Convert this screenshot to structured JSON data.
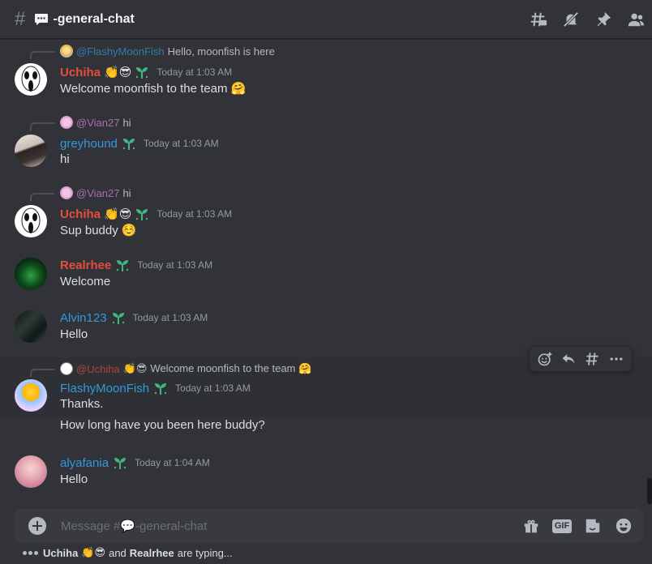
{
  "header": {
    "channel_emoji": "speech-bubble-emoji",
    "title": "-general-chat",
    "tools": [
      "threads-icon",
      "mute-bell-icon",
      "pin-icon",
      "member-list-icon"
    ]
  },
  "messages": [
    {
      "reply_to": {
        "name": "@FlashyMoonFish",
        "text": "Hello, moonfish is here"
      },
      "author": "Uchiha",
      "author_emoji": "👏😎",
      "time": "Today at 1:03 AM",
      "lines": [
        "Welcome moonfish to the team 🤗"
      ]
    },
    {
      "reply_to": {
        "name": "@Vian27",
        "text": "hi"
      },
      "author": "greyhound",
      "author_emoji": "",
      "time": "Today at 1:03 AM",
      "lines": [
        "hi"
      ]
    },
    {
      "reply_to": {
        "name": "@Vian27",
        "text": "hi"
      },
      "author": "Uchiha",
      "author_emoji": "👏😎",
      "time": "Today at 1:03 AM",
      "lines": [
        "Sup buddy ☺️"
      ]
    },
    {
      "author": "Realrhee",
      "author_emoji": "",
      "time": "Today at 1:03 AM",
      "lines": [
        "Welcome"
      ]
    },
    {
      "author": "Alvin123",
      "author_emoji": "",
      "time": "Today at 1:03 AM",
      "lines": [
        "Hello"
      ]
    },
    {
      "reply_to": {
        "name": "@Uchiha",
        "emoji": "👏😎",
        "text": "Welcome moonfish to the team 🤗"
      },
      "author": "FlashyMoonFish",
      "author_emoji": "",
      "time": "Today at 1:03 AM",
      "lines": [
        "Thanks.",
        "How long have you been here buddy?"
      ]
    },
    {
      "author": "alyafania",
      "author_emoji": "",
      "time": "Today at 1:04 AM",
      "lines": [
        "Hello"
      ]
    }
  ],
  "composer": {
    "placeholder": "Message #💬-general-chat",
    "gif_label": "GIF"
  },
  "typing": {
    "user1": "Uchiha",
    "user1_emoji": "👏😎",
    "connector": "and",
    "user2": "Realrhee",
    "suffix": "are typing..."
  },
  "colors": {
    "background": "#313338",
    "red_role": "#e74c3c",
    "blue_role": "#3498db",
    "timestamp": "#949ba4",
    "sprout_green": "#43b581"
  }
}
